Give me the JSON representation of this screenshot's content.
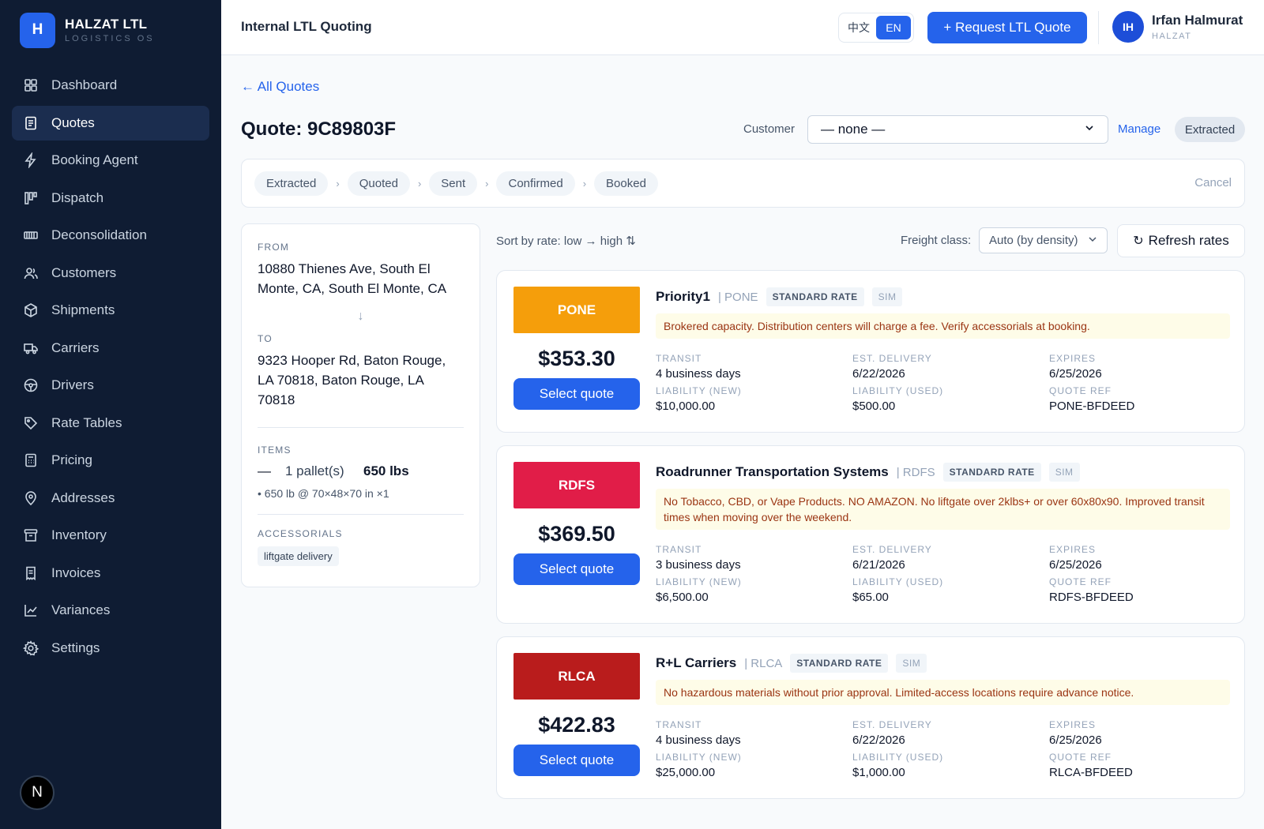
{
  "brand": {
    "logo_letter": "H",
    "name": "HALZAT LTL",
    "subtitle": "LOGISTICS OS"
  },
  "sidebar": {
    "items": [
      {
        "label": "Dashboard",
        "icon": "dashboard-icon",
        "active": false
      },
      {
        "label": "Quotes",
        "icon": "document-icon",
        "active": true
      },
      {
        "label": "Booking Agent",
        "icon": "lightning-icon",
        "active": false
      },
      {
        "label": "Dispatch",
        "icon": "kanban-icon",
        "active": false
      },
      {
        "label": "Deconsolidation",
        "icon": "container-icon",
        "active": false
      },
      {
        "label": "Customers",
        "icon": "users-icon",
        "active": false
      },
      {
        "label": "Shipments",
        "icon": "box-icon",
        "active": false
      },
      {
        "label": "Carriers",
        "icon": "truck-icon",
        "active": false
      },
      {
        "label": "Drivers",
        "icon": "steering-wheel-icon",
        "active": false
      },
      {
        "label": "Rate Tables",
        "icon": "tag-icon",
        "active": false
      },
      {
        "label": "Pricing",
        "icon": "calculator-icon",
        "active": false
      },
      {
        "label": "Addresses",
        "icon": "map-pin-icon",
        "active": false
      },
      {
        "label": "Inventory",
        "icon": "archive-icon",
        "active": false
      },
      {
        "label": "Invoices",
        "icon": "receipt-icon",
        "active": false
      },
      {
        "label": "Variances",
        "icon": "line-chart-icon",
        "active": false
      },
      {
        "label": "Settings",
        "icon": "gear-icon",
        "active": false
      }
    ],
    "footer_badge": "N"
  },
  "topbar": {
    "title": "Internal LTL Quoting",
    "lang_options": [
      "中文",
      "EN"
    ],
    "lang_selected": "EN",
    "request_button": "+ Request LTL Quote",
    "user": {
      "initials": "IH",
      "name": "Irfan Halmurat",
      "org": "HALZAT"
    }
  },
  "quote": {
    "back_link": "← All Quotes",
    "title": "Quote: 9C89803F",
    "customer_label": "Customer",
    "customer_value": "— none —",
    "manage_link": "Manage",
    "status": "Extracted",
    "steps": [
      "Extracted",
      "Quoted",
      "Sent",
      "Confirmed",
      "Booked"
    ],
    "cancel": "Cancel"
  },
  "route": {
    "from_label": "FROM",
    "from": "10880 Thienes Ave, South El Monte, CA, South El Monte, CA",
    "to_label": "TO",
    "to": "9323 Hooper Rd, Baton Rouge, LA 70818, Baton Rouge, LA 70818",
    "items_label": "ITEMS",
    "items_dash": "—",
    "items_qty": "1 pallet(s)",
    "items_weight": "650 lbs",
    "items_detail": "• 650 lb @ 70×48×70 in ×1",
    "accessorials_label": "ACCESSORIALS",
    "accessorials": [
      "liftgate delivery"
    ]
  },
  "rates_toolbar": {
    "sort_label": "Sort by rate: low → high ⇅",
    "freight_class_label": "Freight class:",
    "freight_class_value": "Auto (by density)",
    "refresh_button": "Refresh rates"
  },
  "field_labels": {
    "transit": "TRANSIT",
    "est_delivery": "EST. DELIVERY",
    "expires": "EXPIRES",
    "liability_new": "LIABILITY (NEW)",
    "liability_used": "LIABILITY (USED)",
    "quote_ref": "QUOTE REF"
  },
  "quotes": [
    {
      "code": "PONE",
      "badge_color": "#f59e0b",
      "price": "$353.30",
      "select_label": "Select quote",
      "name": "Priority1",
      "code_label": "| PONE",
      "tag": "STANDARD RATE",
      "sim": "SIM",
      "note": "Brokered capacity. Distribution centers will charge a fee. Verify accessorials at booking.",
      "transit": "4 business days",
      "est_delivery": "6/22/2026",
      "expires": "6/25/2026",
      "liability_new": "$10,000.00",
      "liability_used": "$500.00",
      "quote_ref": "PONE-BFDEED"
    },
    {
      "code": "RDFS",
      "badge_color": "#e11d48",
      "price": "$369.50",
      "select_label": "Select quote",
      "name": "Roadrunner Transportation Systems",
      "code_label": "| RDFS",
      "tag": "STANDARD RATE",
      "sim": "SIM",
      "note": "No Tobacco, CBD, or Vape Products. NO AMAZON. No liftgate over 2klbs+ or over 60x80x90. Improved transit times when moving over the weekend.",
      "transit": "3 business days",
      "est_delivery": "6/21/2026",
      "expires": "6/25/2026",
      "liability_new": "$6,500.00",
      "liability_used": "$65.00",
      "quote_ref": "RDFS-BFDEED"
    },
    {
      "code": "RLCA",
      "badge_color": "#b91c1c",
      "price": "$422.83",
      "select_label": "Select quote",
      "name": "R+L Carriers",
      "code_label": "| RLCA",
      "tag": "STANDARD RATE",
      "sim": "SIM",
      "note": "No hazardous materials without prior approval. Limited-access locations require advance notice.",
      "transit": "4 business days",
      "est_delivery": "6/22/2026",
      "expires": "6/25/2026",
      "liability_new": "$25,000.00",
      "liability_used": "$1,000.00",
      "quote_ref": "RLCA-BFDEED"
    }
  ]
}
